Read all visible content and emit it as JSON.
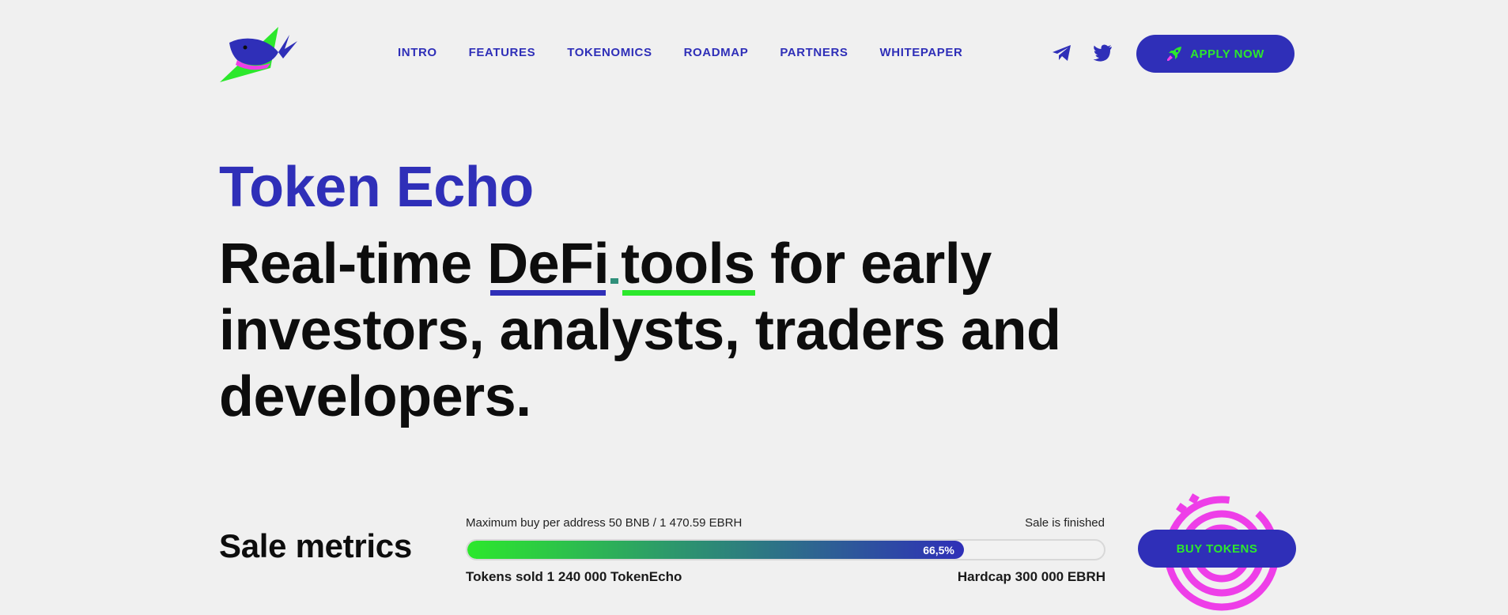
{
  "brand": {
    "logo_icon": "whale-jet-logo"
  },
  "nav": {
    "items": [
      {
        "label": "INTRO"
      },
      {
        "label": "FEATURES"
      },
      {
        "label": "TOKENOMICS"
      },
      {
        "label": "ROADMAP"
      },
      {
        "label": "PARTNERS"
      },
      {
        "label": "WHITEPAPER"
      }
    ]
  },
  "social": {
    "icons": [
      "telegram-icon",
      "twitter-icon"
    ]
  },
  "header": {
    "apply_label": "APPLY NOW",
    "apply_icon": "rocket-icon"
  },
  "hero": {
    "title": "Token Echo",
    "headline_pre": "Real-time ",
    "headline_defi": "DeFi",
    "headline_tools": "tools",
    "headline_post": " for early investors, analysts, traders and developers."
  },
  "sale": {
    "title": "Sale metrics",
    "max_buy": "Maximum buy per address 50 BNB / 1 470.59 EBRH",
    "status": "Sale is finished",
    "progress_label": "66,5%",
    "progress_fraction": 0.78,
    "tokens_sold": "Tokens sold 1 240 000 TokenEcho",
    "hardcap": "Hardcap 300 000 EBRH",
    "buy_label": "BUY TOKENS"
  },
  "colors": {
    "primary": "#2f2fb8",
    "accent": "#2ce82c",
    "magenta": "#ee3ee8",
    "background": "#f0f0f0",
    "text": "#0d0d0d"
  }
}
